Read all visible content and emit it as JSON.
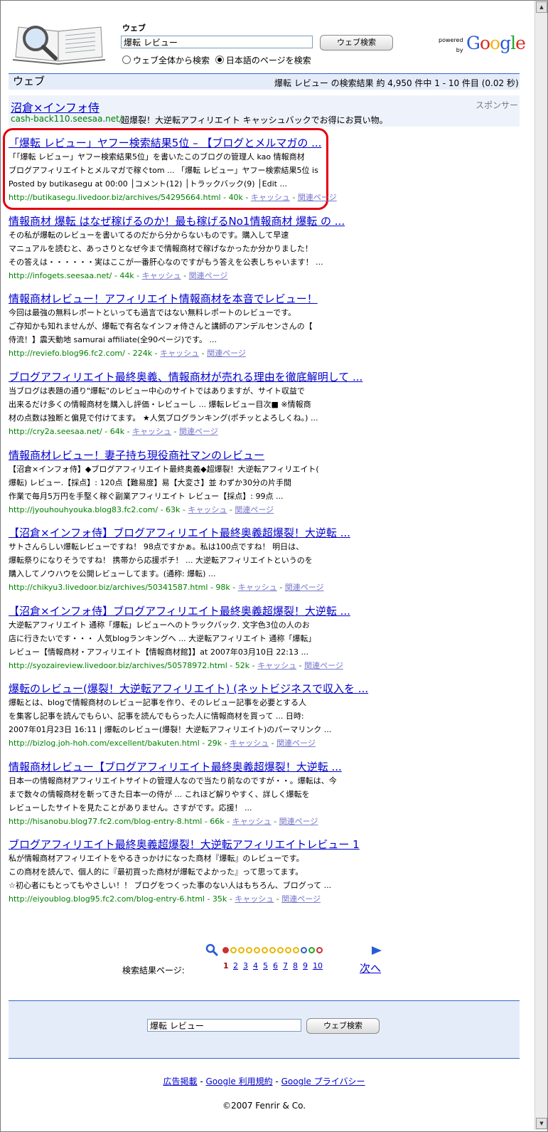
{
  "header": {
    "web_label": "ウェブ",
    "query": "爆転 レビュー",
    "search_button": "ウェブ検索",
    "radio_all": "ウェブ全体から検索",
    "radio_ja": "日本語のページを検索",
    "powered_1": "powered",
    "powered_2": "by",
    "google": "Google"
  },
  "bar": {
    "title": "ウェブ",
    "stats": "爆転 レビュー の検索結果 約 4,950 件中 1 - 10 件目 (0.02 秒)"
  },
  "ad": {
    "label": "スポンサー",
    "title": "沼倉×インフォ侍",
    "url": "cash-back110.seesaa.net/",
    "desc": "超爆裂！大逆転アフィリエイト キャッシュバックでお得にお買い物。"
  },
  "results": [
    {
      "title": "「爆転 レビュー」ヤフー検索結果5位 – 【ブログとメルマガの ...",
      "snippet": "「「爆転 レビュー」ヤフー検索結果5位」を書いたこのブログの管理人 kao 情報商材\nブログアフィリエイトとメルマガで稼ぐtom ... 「爆転 レビュー」ヤフー検索結果5位 is\nPosted by butikasegu at 00:00 │コメント(12) │トラックバック(9) │Edit ...",
      "url": "http://butikasegu.livedoor.biz/archives/54295664.html - 40k"
    },
    {
      "title": "情報商材 爆転 はなぜ稼げるのか！最も稼げるNo1情報商材 爆転 の ...",
      "snippet": "その私が爆転のレビューを書いてるのだから分からないものです。購入して早速\nマニュアルを読むと、あっさりとなぜ今まで情報商材で稼げなかったか分かりました！\nその答えは・・・・・・実はここが一番肝心なのですがもう答えを公表しちゃいます！ ...",
      "url": "http://infogets.seesaa.net/ - 44k"
    },
    {
      "title": "情報商材レビュー！アフィリエイト情報商材を本音でレビュー！",
      "snippet": "今回は最強の無料レポートといっても過言ではない無料レポートのレビューです。\nご存知かも知れませんが、爆転で有名なインフォ侍さんと講師のアンデルセンさんの【\n侍流！】震天動地 samurai affiliate(全90ページ)です。 ...",
      "url": "http://reviefo.blog96.fc2.com/ - 224k"
    },
    {
      "title": "ブログアフィリエイト最終奥義、情報商材が売れる理由を徹底解明して ...",
      "snippet": "当ブログは表題の通り\"爆転\"のレビュー中心のサイトではありますが、サイト収益で\n出来るだけ多くの情報商材を購入し評価・レビューし ... 爆転レビュー目次■ ※情報商\n材の点数は独断と偏見で付けてます。 ★人気ブログランキング(ポチッとよろしくね。) ...",
      "url": "http://cry2a.seesaa.net/ - 64k"
    },
    {
      "title": "情報商材レビュー！妻子持ち現役商社マンのレビュー",
      "snippet": "【沼倉×インフォ侍】◆ブログアフィリエイト最終奥義◆超爆裂！大逆転アフィリエイト(\n爆転) レビュー.【採点】: 120点【難易度】易【大変さ】並 わずか30分の片手間\n作業で毎月5万円を手堅く稼ぐ副業アフィリエイト レビュー【採点】: 99点 ...",
      "url": "http://jyouhouhyouka.blog83.fc2.com/ - 63k"
    },
    {
      "title": "【沼倉×インフォ侍】ブログアフィリエイト最終奥義超爆裂！大逆転 ...",
      "snippet": "サトさんらしい爆転レビューですね！ 98点ですかぁ。私は100点ですね！ 明日は、\n爆転祭りになりそうですね！ 携帯から応援ポチ！ ... 大逆転アフィリエイトというのを\n購入してノウハウを公開レビューしてます。(通称: 爆転) ...",
      "url": "http://chikyu3.livedoor.biz/archives/50341587.html - 98k"
    },
    {
      "title": "【沼倉×インフォ侍】ブログアフィリエイト最終奥義超爆裂！大逆転 ...",
      "snippet": "大逆転アフィリエイト 通称「爆転」レビューへのトラックバック. 文字色3位の人のお\n店に行きたいです・・・ 人気blogランキングへ ... 大逆転アフィリエイト 通称「爆転」\nレビュー【情報商材・アフィリエイト【情報商材館】】at 2007年03月10日 22:13 ...",
      "url": "http://syozaireview.livedoor.biz/archives/50578972.html - 52k"
    },
    {
      "title": "爆転のレビュー(爆裂！大逆転アフィリエイト) (ネットビジネスで収入を ...",
      "snippet": "爆転とは、blogで情報商材のレビュー記事を作り、そのレビュー記事を必要とする人\nを集客し記事を読んでもらい、記事を読んでもらった人に情報商材を買って ... 日時:\n2007年01月23日 16:11 | 爆転のレビュー(爆裂！大逆転アフィリエイト)のパーマリンク ...",
      "url": "http://bizlog.joh-hoh.com/excellent/bakuten.html - 29k"
    },
    {
      "title": "情報商材レビュー【ブログアフィリエイト最終奥義超爆裂！大逆転 ...",
      "snippet": "日本一の情報商材アフィリエイトサイトの管理人なので当たり前なのですが・・。爆転は、今\nまで数々の情報商材を斬ってきた日本一の侍が ... これほど解りやすく、詳しく爆転を\nレビューしたサイトを見たことがありません。さすがです。応援！ ...",
      "url": "http://hisanobu.blog77.fc2.com/blog-entry-8.html - 66k"
    },
    {
      "title": "ブログアフィリエイト最終奥義超爆裂！大逆転アフィリエイトレビュー 1",
      "snippet": "私が情報商材アフィリエイトをやるきっかけになった商材『爆転』のレビューです。\nこの商材を読んで、個人的に『最初買った商材が爆転でよかった』って思ってます。\n☆初心者にもとってもやさしい！！ ブログをつくった事のない人はもちろん、ブログって ...",
      "url": "http://eiyoublog.blog95.fc2.com/blog-entry-6.html - 35k"
    }
  ],
  "result_links": {
    "sep": " - ",
    "cache": "キャッシュ",
    "related": "関連ページ"
  },
  "pager": {
    "label": "検索結果ページ:",
    "pages": [
      "1",
      "2",
      "3",
      "4",
      "5",
      "6",
      "7",
      "8",
      "9",
      "10"
    ],
    "next": "次へ"
  },
  "bottom": {
    "query": "爆転 レビュー",
    "search_button": "ウェブ検索"
  },
  "footer": {
    "link1": "広告掲載",
    "link2": "Google 利用規約",
    "link3": "Google プライバシー",
    "sep": " - ",
    "copyright": "©2007 Fenrir & Co."
  },
  "colors": {
    "link": "#0000cc",
    "url_green": "#008000",
    "bar_bg": "#e5ecf9",
    "highlight": "#e4000f"
  },
  "icons": [
    "book-magnifier-logo",
    "magnifier-icon",
    "next-arrow-icon"
  ]
}
